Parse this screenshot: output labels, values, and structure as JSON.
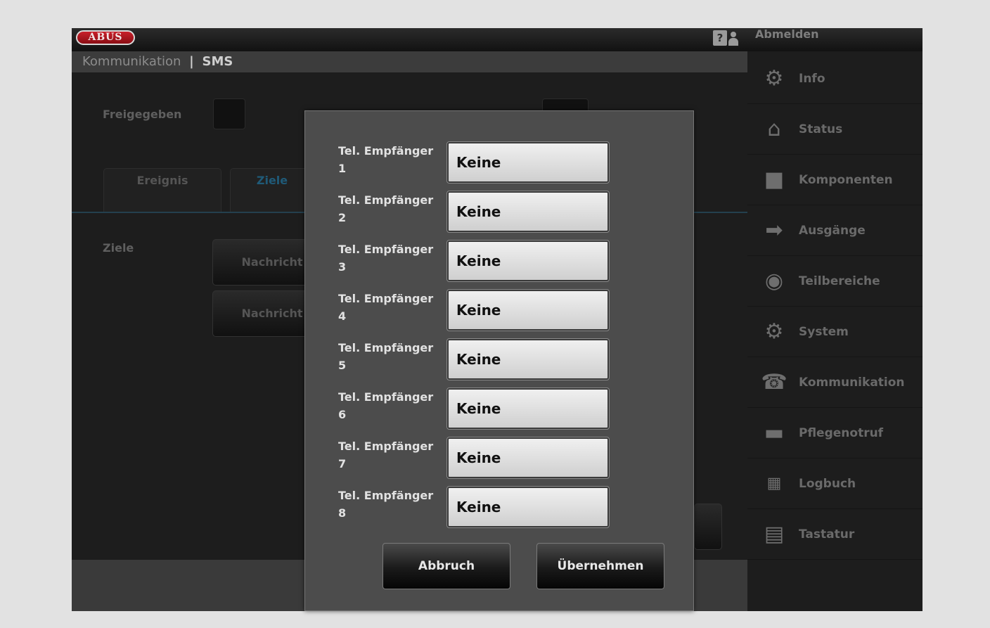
{
  "header": {
    "logo": "ABUS",
    "help_icon": "help-person-icon",
    "logout_label": "Abmelden"
  },
  "breadcrumb": {
    "section": "Kommunikation",
    "separator": "|",
    "page": "SMS"
  },
  "background": {
    "enabled_label": "Freigegeben",
    "tabs": [
      "Ereignis",
      "Ziele"
    ],
    "targets_label": "Ziele",
    "message_buttons": [
      "Nachricht",
      "Nachricht"
    ]
  },
  "sidebar": {
    "items": [
      {
        "label": "Info",
        "icon": "gear-icon"
      },
      {
        "label": "Status",
        "icon": "home-icon"
      },
      {
        "label": "Komponenten",
        "icon": "square-icon"
      },
      {
        "label": "Ausgänge",
        "icon": "exit-arrow-icon"
      },
      {
        "label": "Teilbereiche",
        "icon": "pie-segments-icon"
      },
      {
        "label": "System",
        "icon": "gear-icon"
      },
      {
        "label": "Kommunikation",
        "icon": "telephone-icon"
      },
      {
        "label": "Pflegenotruf",
        "icon": "bed-icon"
      },
      {
        "label": "Logbuch",
        "icon": "calendar-icon"
      },
      {
        "label": "Tastatur",
        "icon": "keypad-icon"
      }
    ]
  },
  "dialog": {
    "recipient_label": "Tel. Empfänger",
    "rows": [
      {
        "number": "1",
        "value": "Keine"
      },
      {
        "number": "2",
        "value": "Keine"
      },
      {
        "number": "3",
        "value": "Keine"
      },
      {
        "number": "4",
        "value": "Keine"
      },
      {
        "number": "5",
        "value": "Keine"
      },
      {
        "number": "6",
        "value": "Keine"
      },
      {
        "number": "7",
        "value": "Keine"
      },
      {
        "number": "8",
        "value": "Keine"
      }
    ],
    "cancel_label": "Abbruch",
    "apply_label": "Übernehmen"
  },
  "colors": {
    "logo_red": "#b3141d",
    "modal_bg": "#4c4c4c",
    "sidebar_bg": "#1d1d1d"
  }
}
